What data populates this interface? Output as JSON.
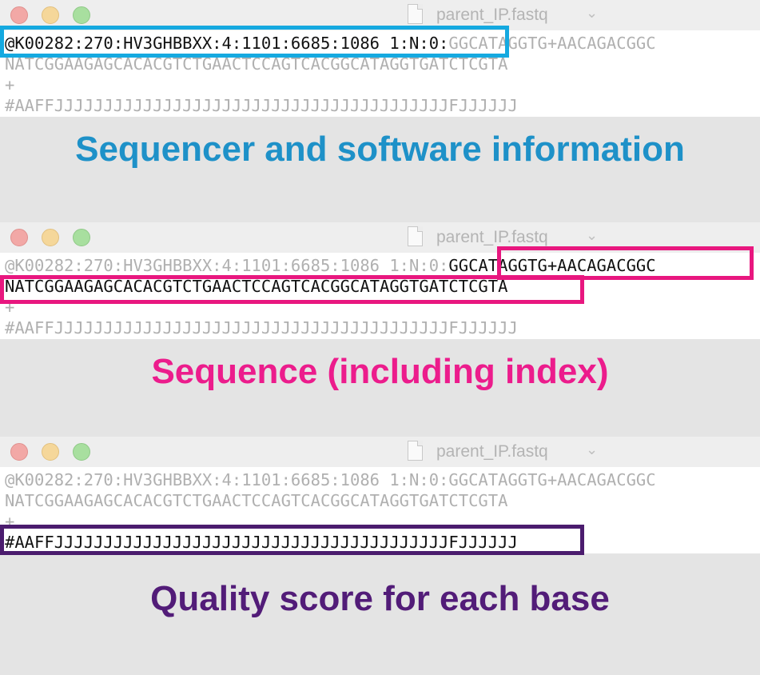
{
  "window": {
    "filename": "parent_IP.fastq",
    "chevron_icon": "chevron-down-icon",
    "file_icon": "document-icon"
  },
  "fastq": {
    "header_part": "@K00282:270:HV3GHBBXX:4:1101:6685:1086 1:N:0:",
    "index_part": "GGCATAGGTG+AACAGACGGC",
    "sequence": "NATCGGAAGAGCACACGTCTGAACTCCAGTCACGGCATAGGTGATCTCGTA",
    "separator": "+",
    "quality": "#AAFFJJJJJJJJJJJJJJJJJJJJJJJJJJJJJJJJJJJJJJJJFJJJJJJ"
  },
  "captions": {
    "panel1": "Sequencer and software information",
    "panel2": "Sequence (including index)",
    "panel3": "Quality score for each base"
  },
  "colors": {
    "panel1": "#1e91c8",
    "panel2": "#ec1c8c",
    "panel3": "#521c78",
    "box1": "#15a9e0",
    "box2": "#e8177f",
    "box3": "#4b1c6e"
  }
}
